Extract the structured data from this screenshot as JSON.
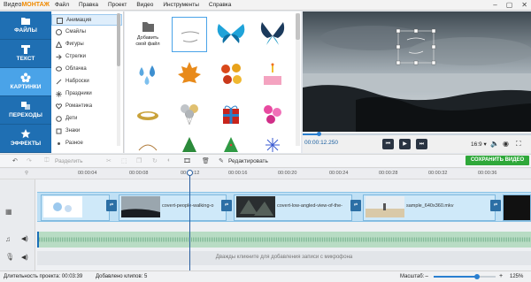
{
  "app": {
    "logo_prefix": "Видео",
    "logo_brand": "МОНТАЖ",
    "menu": [
      "Файл",
      "Правка",
      "Проект",
      "Видео",
      "Инструменты",
      "Справка"
    ]
  },
  "nav": [
    {
      "label": "ФАЙЛЫ",
      "icon": "folder-icon"
    },
    {
      "label": "ТЕКСТ",
      "icon": "text-icon"
    },
    {
      "label": "КАРТИНКИ",
      "icon": "flower-icon"
    },
    {
      "label": "ПЕРЕХОДЫ",
      "icon": "transition-icon"
    },
    {
      "label": "ЭФФЕКТЫ",
      "icon": "star-icon"
    }
  ],
  "categories": [
    "Анимация",
    "Смайлы",
    "Фигуры",
    "Стрелки",
    "Облачка",
    "Наброски",
    "Праздники",
    "Романтика",
    "Дети",
    "Знаки",
    "Разное"
  ],
  "add_file_label": [
    "Добавить",
    "свой файл"
  ],
  "preview": {
    "timecode": "00:00:12.250",
    "ratio": "16:9"
  },
  "toolbar": {
    "split": "Разделить",
    "edit": "Редактировать",
    "save": "СОХРАНИТЬ ВИДЕО"
  },
  "ruler": [
    "00:00:04",
    "00:00:08",
    "00:00:12",
    "00:00:16",
    "00:00:20",
    "00:00:24",
    "00:00:28",
    "00:00:32",
    "00:00:36"
  ],
  "clips": [
    "covert-people-walking-o",
    "covert-low-angled-view-of-the-",
    "sample_640x360.mkv"
  ],
  "mic_hint": "Дважды кликните для добавления записи с микрофона",
  "status": {
    "duration": "Длительность проекта: 00:03:39",
    "clips_added": "Добавлено клипов: 5",
    "zoom_label": "Масштаб:",
    "zoom_value": "125%"
  },
  "colors": {
    "nav_bg": "#1f6fb3",
    "nav_active": "#4aa3e8",
    "save_green": "#2fa83a",
    "brand_orange": "#f08a00"
  }
}
